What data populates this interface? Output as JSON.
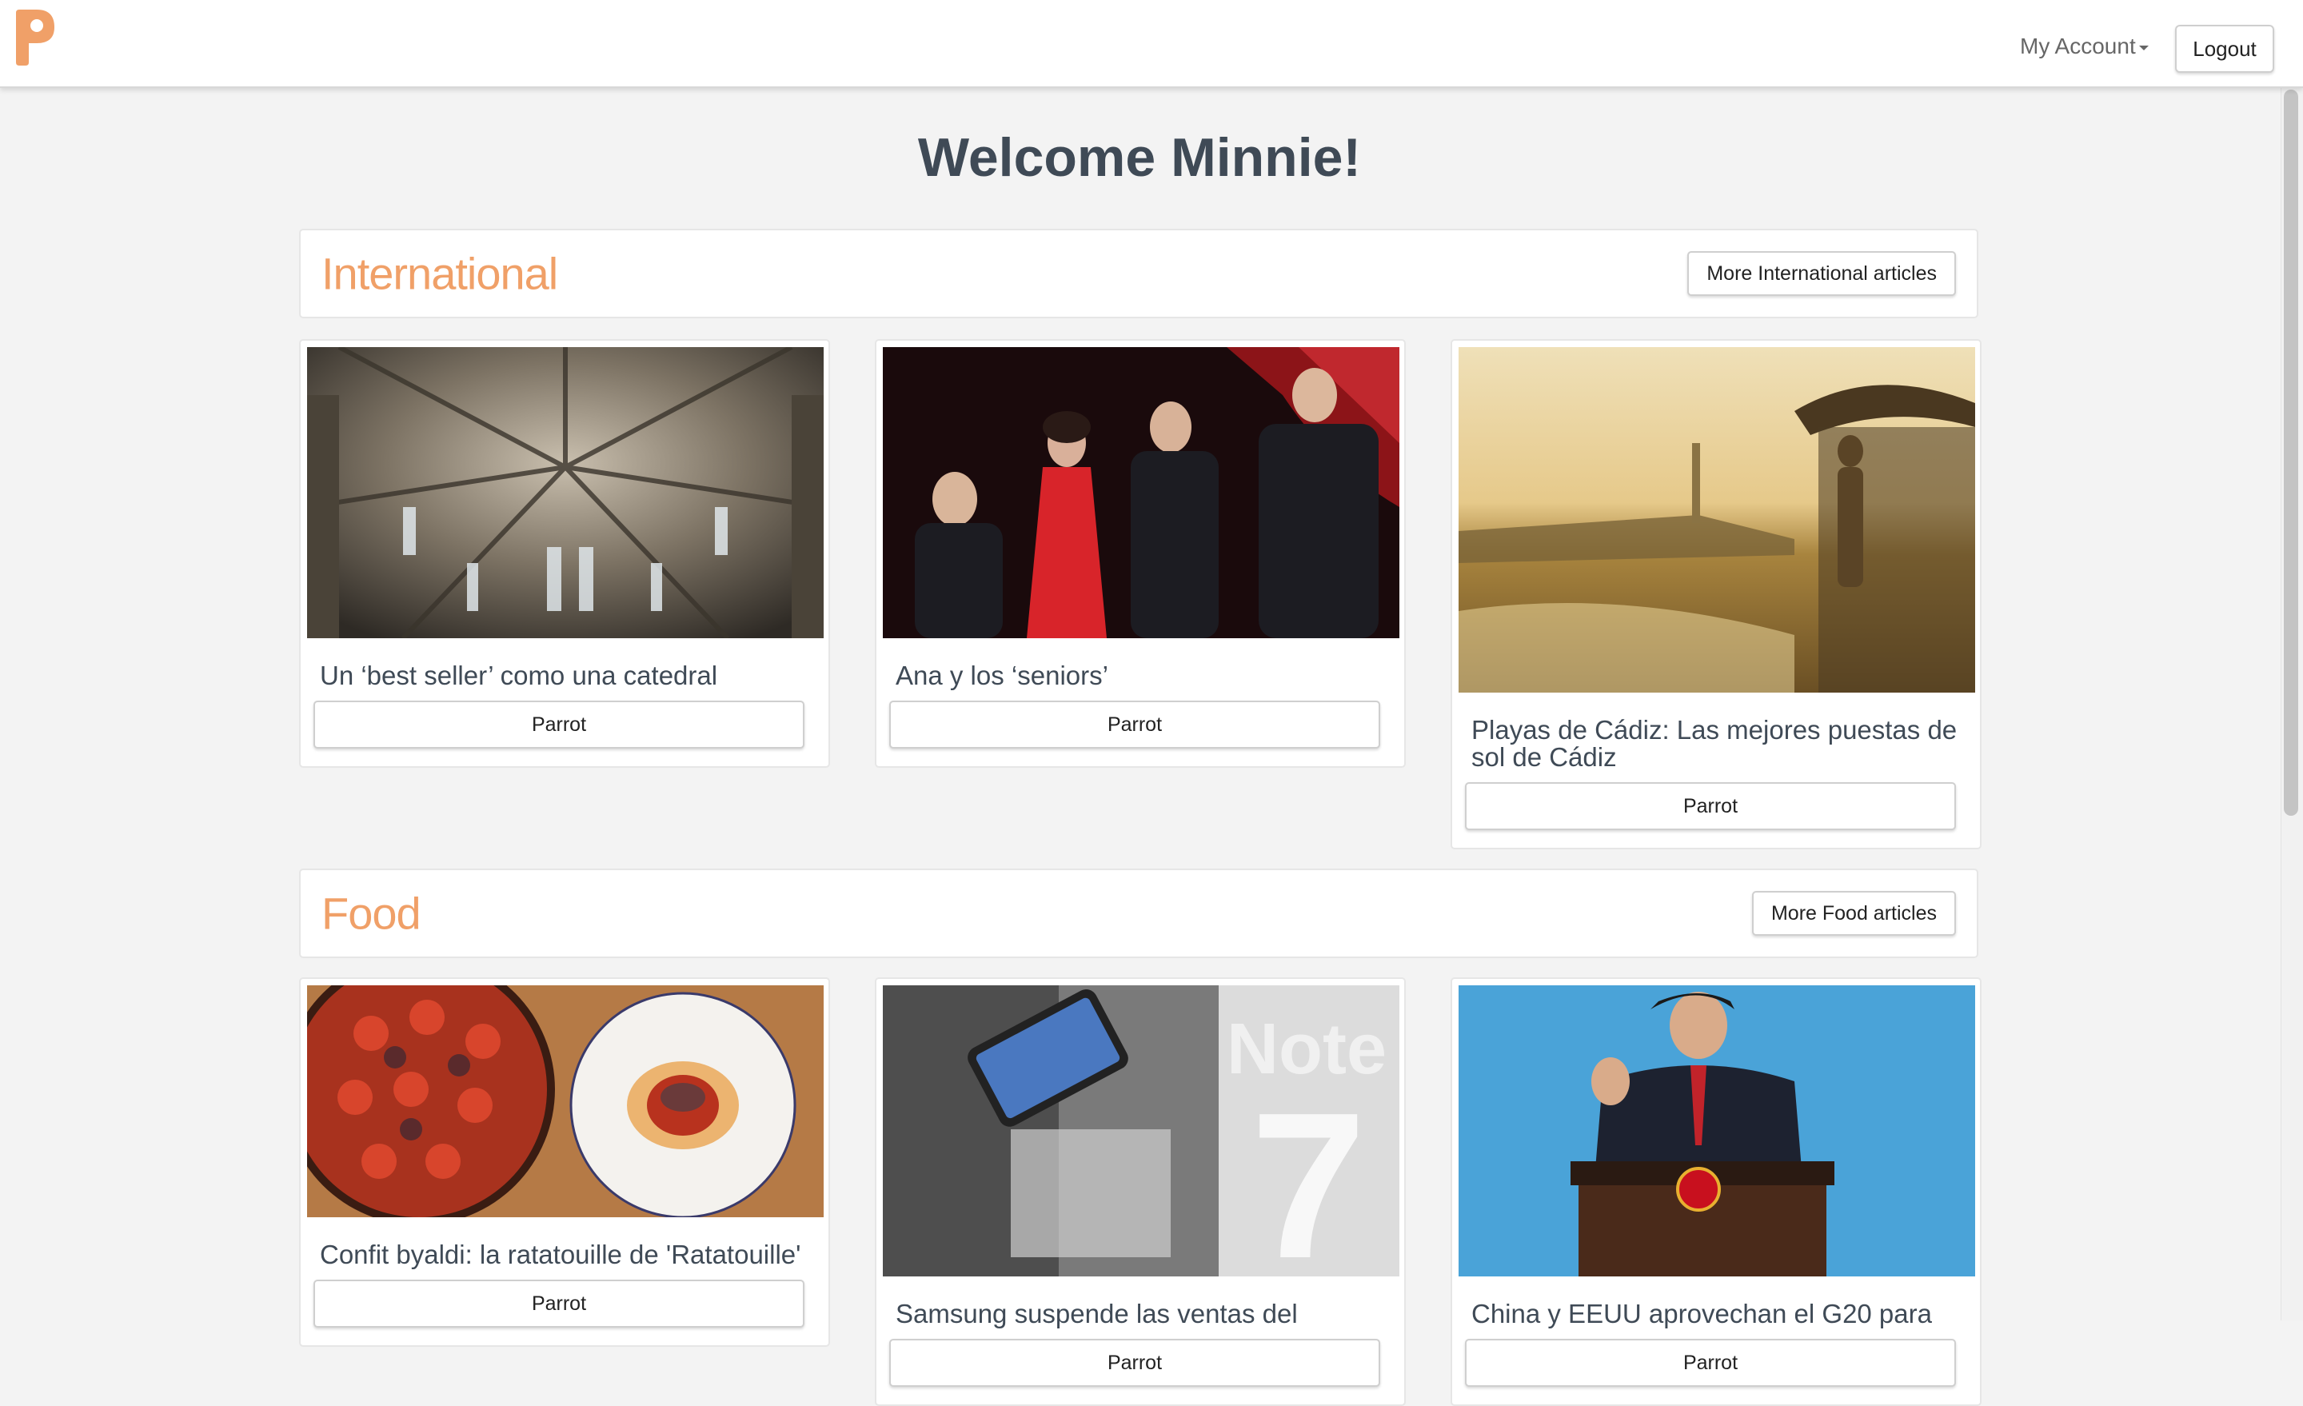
{
  "navbar": {
    "logo_icon": "parrot-logo-icon",
    "account_label": "My Account",
    "logout_label": "Logout",
    "brand_color": "#f0a068"
  },
  "welcome": "Welcome Minnie!",
  "sections": [
    {
      "title": "International",
      "more_label": "More International articles",
      "articles": [
        {
          "title": "Un ‘best seller’ como una catedral",
          "source": "Parrot",
          "image": "cathedral-vault-image"
        },
        {
          "title": "Ana y los ‘seniors’",
          "source": "Parrot",
          "image": "concert-singers-image"
        },
        {
          "title": "Playas de Cádiz: Las mejores puestas de sol de Cádiz",
          "source": "Parrot",
          "image": "beach-sunset-image"
        }
      ]
    },
    {
      "title": "Food",
      "more_label": "More Food articles",
      "articles": [
        {
          "title": "Confit byaldi: la ratatouille de 'Ratatouille'",
          "source": "Parrot",
          "image": "ratatouille-dish-image"
        },
        {
          "title": "Samsung suspende las ventas del",
          "source": "Parrot",
          "image": "smartphone-display-image"
        },
        {
          "title": "China y EEUU aprovechan el G20 para",
          "source": "Parrot",
          "image": "podium-speaker-image"
        }
      ]
    }
  ]
}
